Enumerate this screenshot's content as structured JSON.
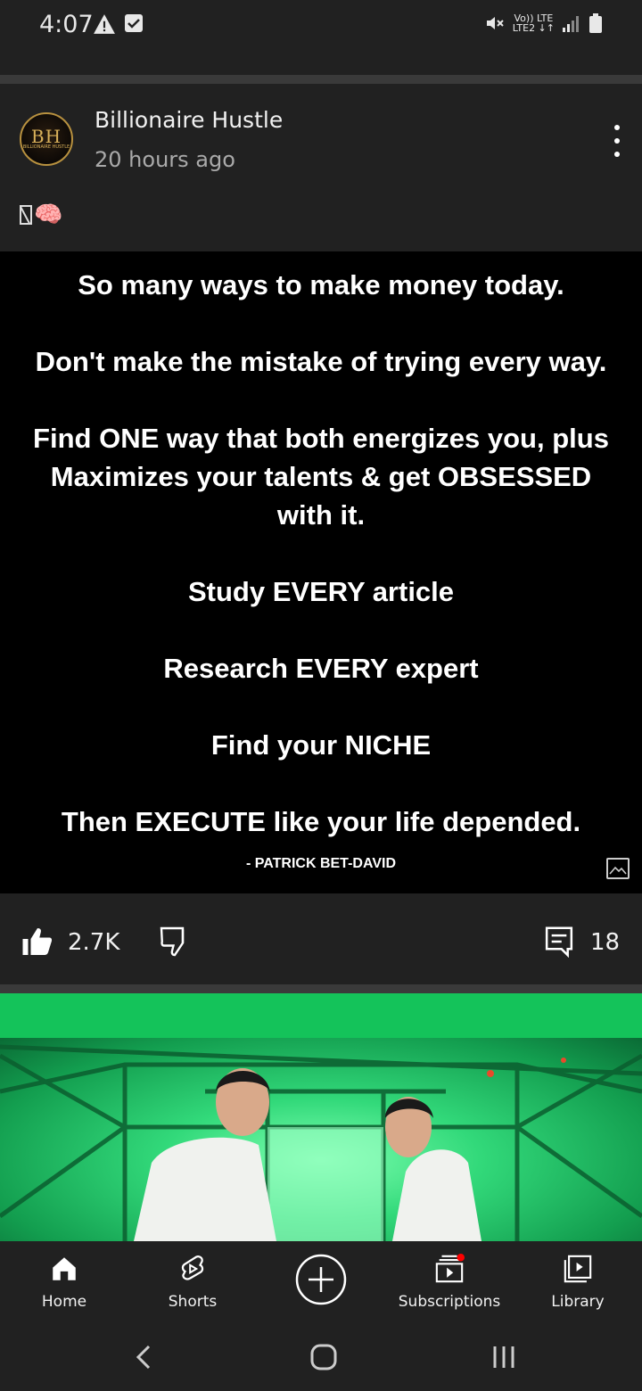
{
  "status_bar": {
    "time": "4:07",
    "network_line1": "Vo)) LTE",
    "network_line2": "LTE2 ↓↑",
    "icons": [
      "warning-icon",
      "checkbox-notification-icon",
      "mute-icon",
      "signal-icon",
      "battery-icon"
    ]
  },
  "post": {
    "channel_name": "Billionaire Hustle",
    "avatar_text": "BH",
    "avatar_subtext": "BILLIONAIRE HUSTLE",
    "time_ago": "20 hours ago",
    "emoji_text": "🧠",
    "quote_lines": [
      "So many ways to make money today.",
      "Don't make the mistake of trying every way.",
      "Find ONE way that both energizes you, plus",
      "Maximizes your talents & get OBSESSED",
      "with it.",
      "Study EVERY article",
      "Research EVERY expert",
      "Find your NICHE",
      "Then EXECUTE like your life depended."
    ],
    "quote_author": "- PATRICK BET-DAVID",
    "likes": "2.7K",
    "comments": "18"
  },
  "bottom_nav": {
    "items": [
      {
        "label": "Home",
        "icon": "home-icon",
        "active": true
      },
      {
        "label": "Shorts",
        "icon": "shorts-icon"
      },
      {
        "label": "",
        "icon": "create-icon"
      },
      {
        "label": "Subscriptions",
        "icon": "subscriptions-icon",
        "badge": true
      },
      {
        "label": "Library",
        "icon": "library-icon"
      }
    ]
  },
  "colors": {
    "background": "#212121",
    "divider": "#3a3a3a",
    "thumb_green": "#14c35a",
    "badge_red": "#ff0000"
  }
}
